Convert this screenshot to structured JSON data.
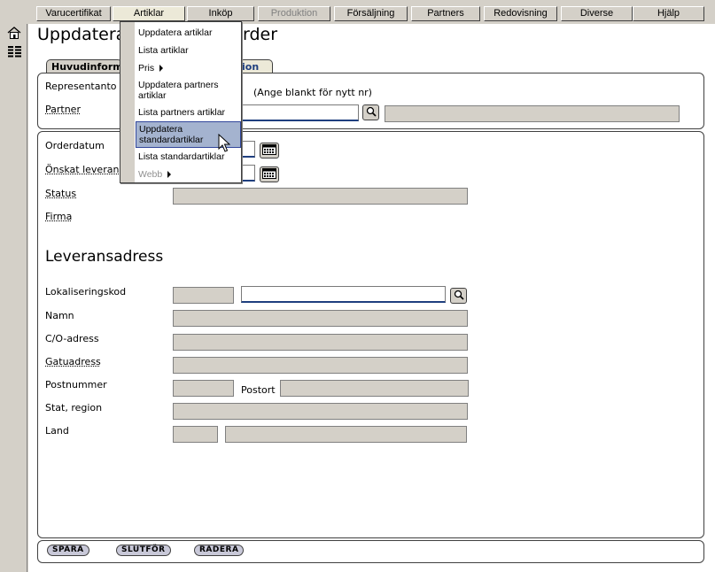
{
  "menu": {
    "tabs": [
      {
        "label": "Varucertifikat"
      },
      {
        "label": "Artiklar"
      },
      {
        "label": "Inköp"
      },
      {
        "label": "Produktion"
      },
      {
        "label": "Försäljning"
      },
      {
        "label": "Partners"
      },
      {
        "label": "Redovisning"
      },
      {
        "label": "Diverse"
      },
      {
        "label": "Hjälp"
      }
    ]
  },
  "dropdown": {
    "items": [
      {
        "label": "Uppdatera artiklar"
      },
      {
        "label": "Lista artiklar"
      },
      {
        "label": "Pris"
      },
      {
        "label": "Uppdatera partners artiklar"
      },
      {
        "label": "Lista partners artiklar"
      },
      {
        "label": "Uppdatera standardartiklar"
      },
      {
        "label": "Lista standardartiklar"
      },
      {
        "label": "Webb"
      }
    ]
  },
  "page": {
    "title_left": "Uppdatera",
    "title_right": "rder"
  },
  "form_tabs": {
    "main": "Huvudinform",
    "second": "ion"
  },
  "header_section": {
    "representant_label": "Representanto",
    "hint": "(Ange blankt för nytt nr)",
    "partner_label": "Partner"
  },
  "order_section": {
    "orderdatum_label": "Orderdatum",
    "onskat_label": "Önskat leveran",
    "status_label": "Status",
    "firma_label": "Firma"
  },
  "delivery": {
    "heading": "Leveransadress",
    "lokalisering_label": "Lokaliseringskod",
    "namn_label": "Namn",
    "co_label": "C/O-adress",
    "gatu_label": "Gatuadress",
    "postnummer_label": "Postnummer",
    "postort_label": "Postort",
    "stat_label": "Stat, region",
    "land_label": "Land"
  },
  "actions": {
    "save": "SPARA",
    "finish": "SLUTFÖR",
    "delete": "RADERA"
  }
}
